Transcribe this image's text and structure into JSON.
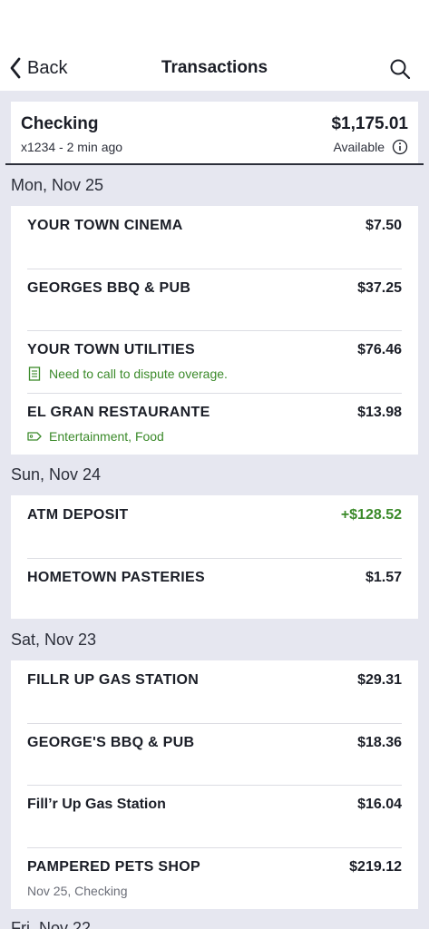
{
  "nav": {
    "back_label": "Back",
    "title": "Transactions"
  },
  "account": {
    "name": "Checking",
    "subtitle": "x1234 - 2 min ago",
    "balance": "$1,175.01",
    "available_label": "Available"
  },
  "groups": [
    {
      "date": "Mon, Nov 25",
      "transactions": [
        {
          "merchant": "YOUR TOWN CINEMA",
          "amount": "$7.50"
        },
        {
          "merchant": "GEORGES BBQ & PUB",
          "amount": "$37.25"
        },
        {
          "merchant": "YOUR TOWN UTILITIES",
          "amount": "$76.46",
          "note": "Need to call to dispute overage."
        },
        {
          "merchant": "EL GRAN RESTAURANTE",
          "amount": "$13.98",
          "tags": "Entertainment, Food"
        }
      ]
    },
    {
      "date": "Sun, Nov 24",
      "transactions": [
        {
          "merchant": "ATM DEPOSIT",
          "amount": "+$128.52"
        },
        {
          "merchant": "HOMETOWN PASTERIES",
          "amount": "$1.57"
        }
      ]
    },
    {
      "date": "Sat, Nov 23",
      "transactions": [
        {
          "merchant": "FILLR UP GAS STATION",
          "amount": "$29.31"
        },
        {
          "merchant": "GEORGE'S BBQ & PUB",
          "amount": "$18.36"
        },
        {
          "merchant": "Fill’r Up Gas Station",
          "amount": "$16.04"
        },
        {
          "merchant": "PAMPERED PETS SHOP",
          "amount": "$219.12",
          "detail": "Nov 25, Checking"
        }
      ]
    },
    {
      "date": "Fri, Nov 22"
    }
  ],
  "colors": {
    "credit": "#3b8a2a",
    "background": "#e6e7f0"
  },
  "icons": [
    "chevron-left-icon",
    "search-icon",
    "info-icon",
    "note-icon",
    "tag-icon"
  ]
}
